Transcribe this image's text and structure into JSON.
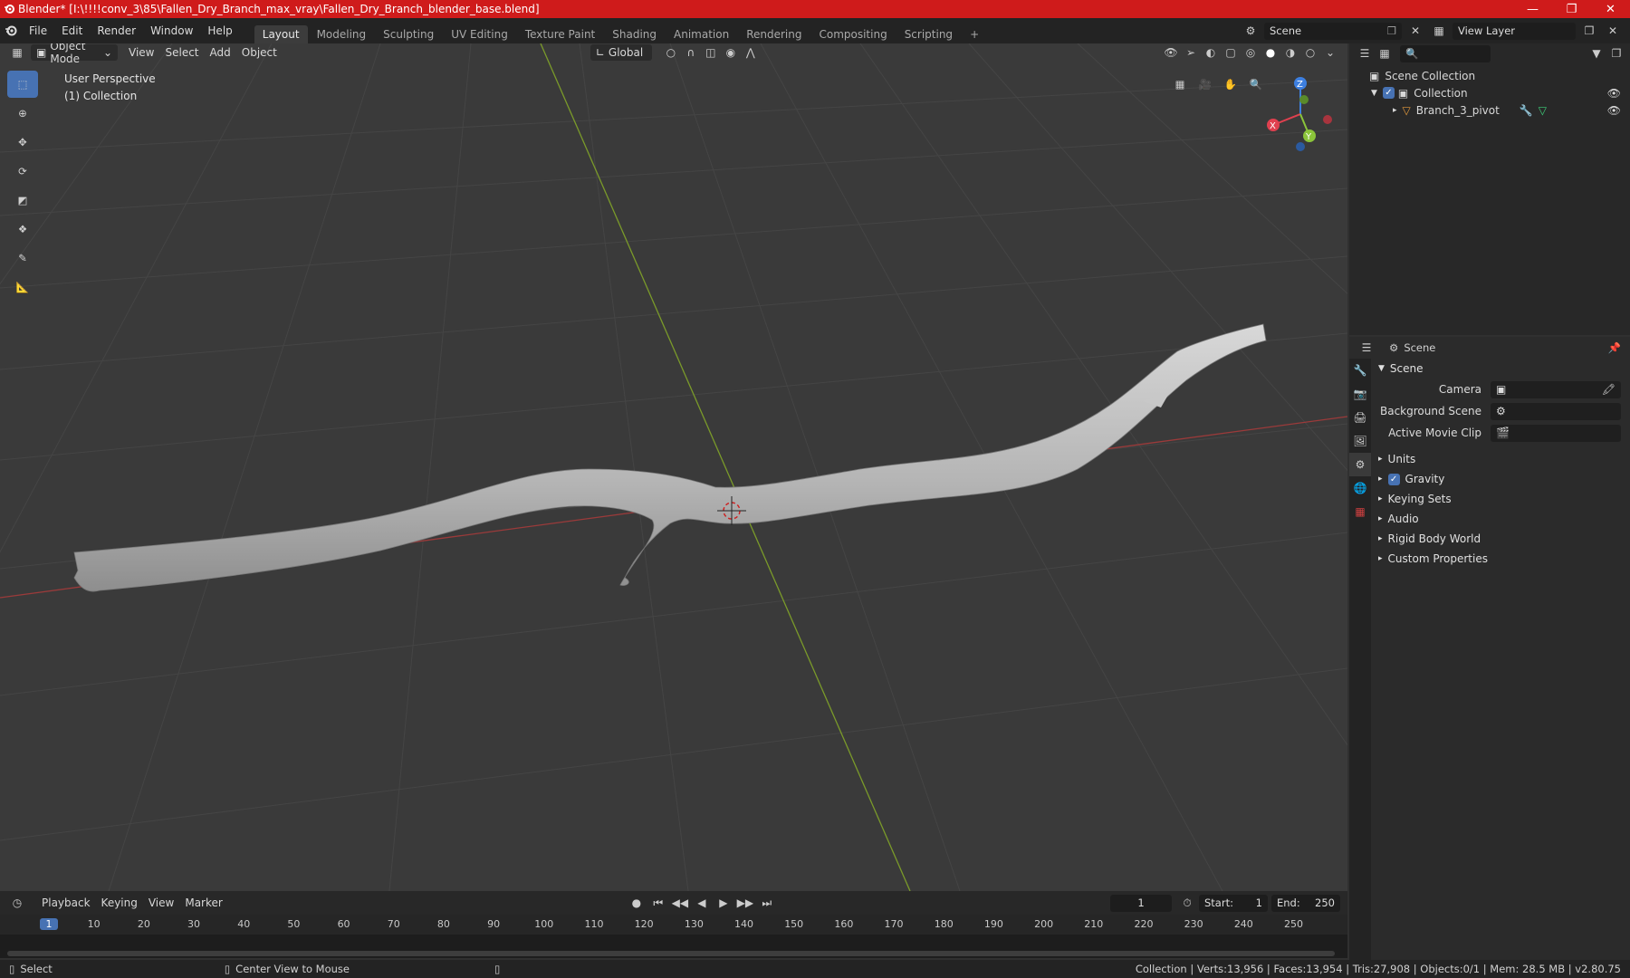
{
  "window": {
    "title": "Blender* [I:\\!!!!conv_3\\85\\Fallen_Dry_Branch_max_vray\\Fallen_Dry_Branch_blender_base.blend]"
  },
  "menu": [
    "File",
    "Edit",
    "Render",
    "Window",
    "Help"
  ],
  "workspaces": [
    "Layout",
    "Modeling",
    "Sculpting",
    "UV Editing",
    "Texture Paint",
    "Shading",
    "Animation",
    "Rendering",
    "Compositing",
    "Scripting"
  ],
  "active_workspace": "Layout",
  "scene_field": "Scene",
  "view_layer_field": "View Layer",
  "viewport_header": {
    "mode": "Object Mode",
    "menus": [
      "View",
      "Select",
      "Add",
      "Object"
    ],
    "orientation": "Global"
  },
  "viewport": {
    "perspective_label": "User Perspective",
    "collection_label": "(1) Collection",
    "gizmo": {
      "x": "X",
      "y": "Y",
      "z": "Z"
    }
  },
  "tools": [
    "select-box-icon",
    "cursor-icon",
    "move-icon",
    "rotate-icon",
    "scale-icon",
    "transform-icon",
    "annotate-icon",
    "measure-icon"
  ],
  "outliner": {
    "root": "Scene Collection",
    "collection": "Collection",
    "object": "Branch_3_pivot"
  },
  "properties": {
    "header": "Scene",
    "panel": "Scene",
    "fields": [
      {
        "label": "Camera",
        "value": ""
      },
      {
        "label": "Background Scene",
        "value": ""
      },
      {
        "label": "Active Movie Clip",
        "value": ""
      }
    ],
    "subpanels": [
      "Units",
      "Gravity",
      "Keying Sets",
      "Audio",
      "Rigid Body World",
      "Custom Properties"
    ],
    "gravity_enabled": true
  },
  "timeline": {
    "menus": [
      "Playback",
      "Keying",
      "View",
      "Marker"
    ],
    "current_frame": "1",
    "start_label": "Start:",
    "start": "1",
    "end_label": "End:",
    "end": "250",
    "ticks": [
      "1",
      "10",
      "20",
      "30",
      "40",
      "50",
      "60",
      "70",
      "80",
      "90",
      "100",
      "110",
      "120",
      "130",
      "140",
      "150",
      "160",
      "170",
      "180",
      "190",
      "200",
      "210",
      "220",
      "230",
      "240",
      "250"
    ]
  },
  "status": {
    "left_action": "Select",
    "middle_action": "Center View to Mouse",
    "stats": "Collection | Verts:13,956 | Faces:13,954 | Tris:27,908 | Objects:0/1 | Mem: 28.5 MB | v2.80.75"
  },
  "colors": {
    "titlebar": "#cf1b1b",
    "accent": "#4772b3",
    "x_axis": "#9b3a3a",
    "y_axis": "#7a9a2a",
    "gizmo_x": "#e0404f",
    "gizmo_y": "#8bc43a",
    "gizmo_z": "#3d7fe0"
  }
}
